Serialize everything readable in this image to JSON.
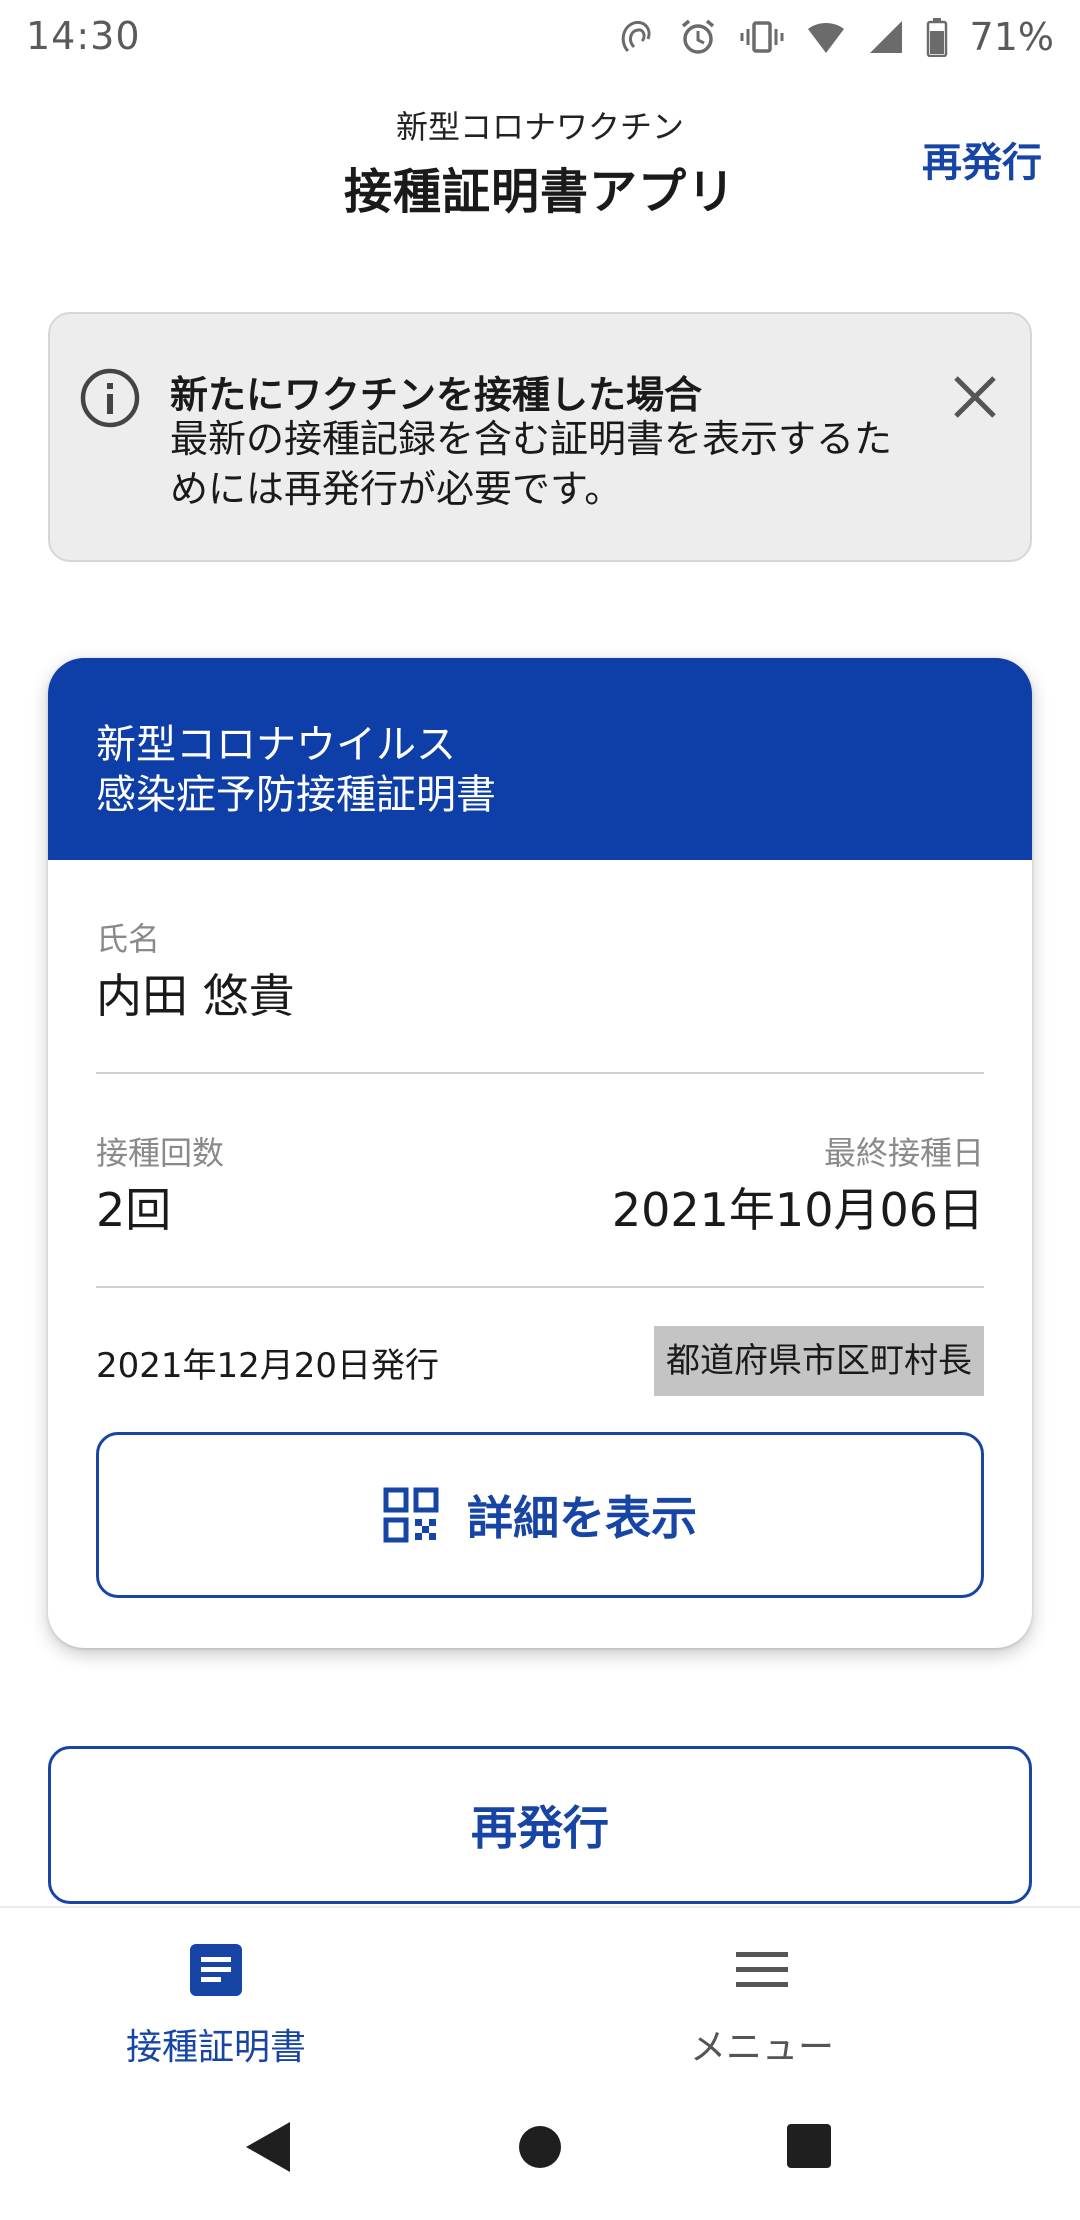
{
  "status_bar": {
    "time": "14:30",
    "battery": "71%",
    "icons": [
      "nfc-icon",
      "alarm-icon",
      "vibrate-icon",
      "wifi-icon",
      "signal-icon",
      "battery-icon"
    ]
  },
  "header": {
    "subtitle": "新型コロナワクチン",
    "title": "接種証明書アプリ",
    "reissue_label": "再発行"
  },
  "notice": {
    "title": "新たにワクチンを接種した場合",
    "body": "最新の接種記録を含む証明書を表示するためには再発行が必要です。"
  },
  "certificate": {
    "header_line1": "新型コロナウイルス",
    "header_line2": "感染症予防接種証明書",
    "name_label": "氏名",
    "name_value": "内田 悠貴",
    "doses_label": "接種回数",
    "doses_value": "2回",
    "last_date_label": "最終接種日",
    "last_date_value": "2021年10月06日",
    "issue_date": "2021年12月20日発行",
    "issuer": "都道府県市区町村長",
    "detail_button_label": "詳細を表示"
  },
  "reissue_button_label": "再発行",
  "bottom_nav": {
    "certificate_label": "接種証明書",
    "menu_label": "メニュー"
  },
  "colors": {
    "accent": "#1745a6",
    "card_header": "#0e3fa8",
    "notice_bg": "#ededed"
  }
}
